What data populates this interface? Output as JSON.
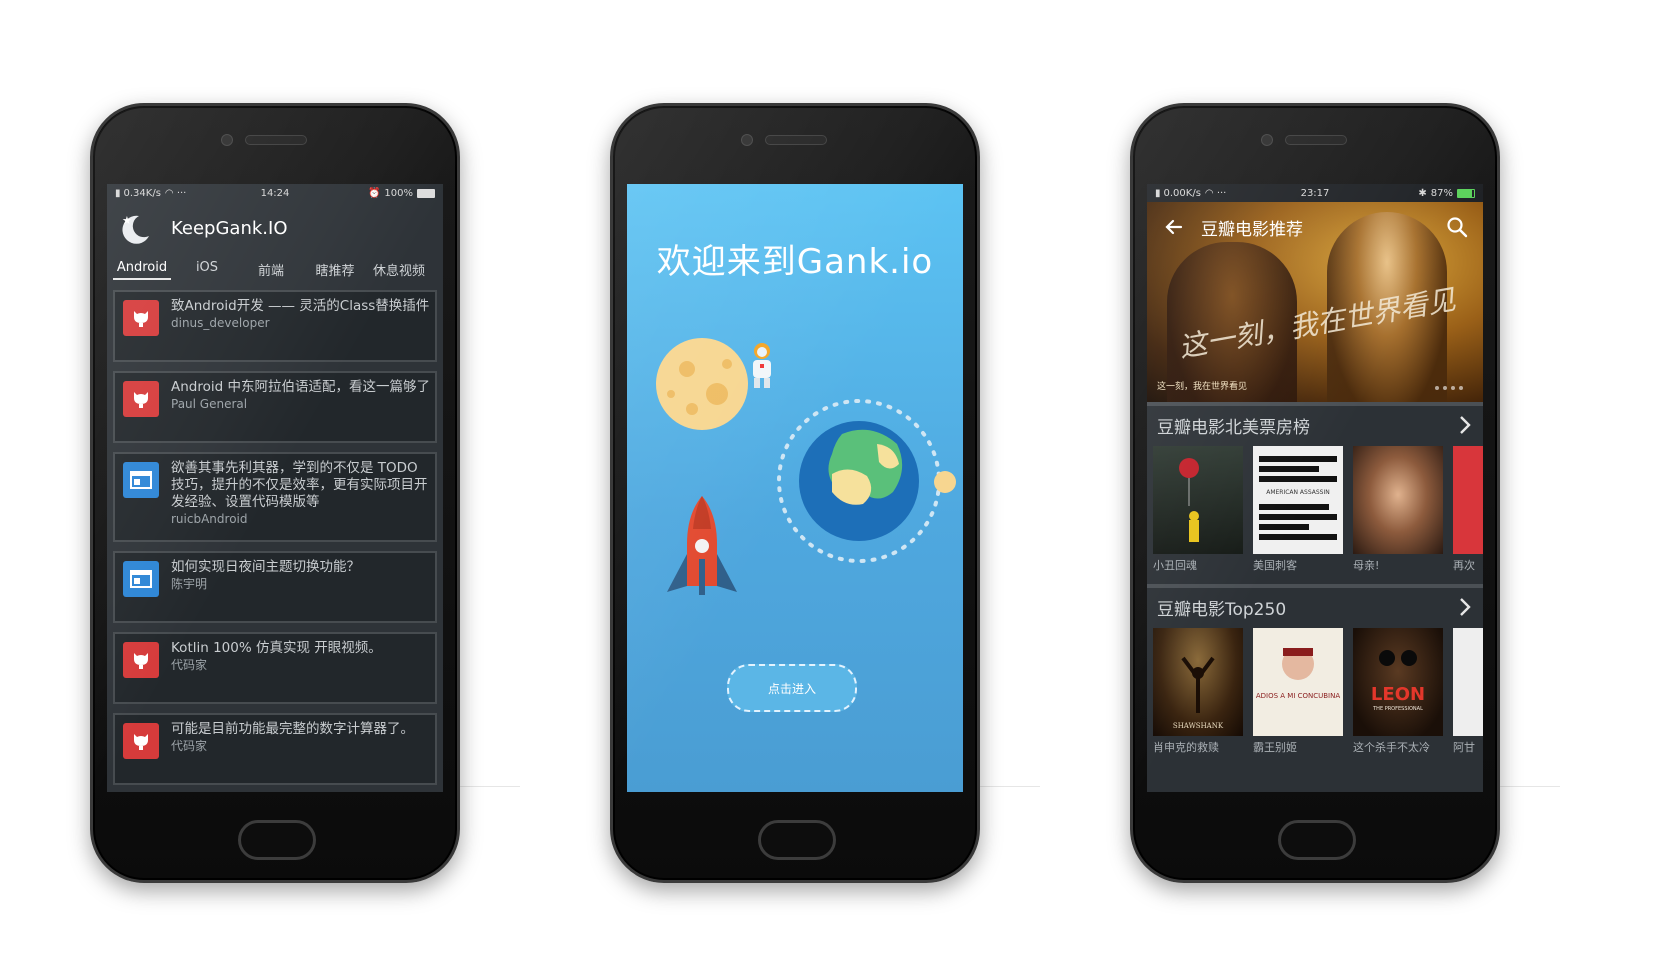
{
  "phone1": {
    "status": {
      "left": "0.34K/s",
      "time": "14:24",
      "battery": "100%",
      "battery_fraction": 1.0
    },
    "app_title": "KeepGank.IO",
    "tabs": [
      {
        "label": "Android",
        "active": true
      },
      {
        "label": "iOS",
        "active": false
      },
      {
        "label": "前端",
        "active": false
      },
      {
        "label": "瞎推荐",
        "active": false
      },
      {
        "label": "休息视频",
        "active": false
      }
    ],
    "items": [
      {
        "icon": "github-icon",
        "title": "致Android开发 —— 灵活的Class替换插件",
        "author": "dinus_developer"
      },
      {
        "icon": "github-icon",
        "title": "Android 中东阿拉伯语适配，看这一篇够了",
        "author": "Paul General"
      },
      {
        "icon": "browser-icon",
        "title": "欲善其事先利其器，学到的不仅是 TODO 技巧，提升的不仅是效率，更有实际项目开发经验、设置代码模版等",
        "author": "ruicbAndroid"
      },
      {
        "icon": "browser-icon",
        "title": "如何实现日夜间主题切换功能？",
        "author": "陈宇明"
      },
      {
        "icon": "github-icon",
        "title": "Kotlin 100% 仿真实现 开眼视频。",
        "author": "代码家"
      },
      {
        "icon": "github-icon",
        "title": "可能是目前功能最完整的数字计算器了。",
        "author": "代码家"
      }
    ]
  },
  "phone2": {
    "welcome": "欢迎来到Gank.io",
    "enter_label": "点击进入"
  },
  "phone3": {
    "status": {
      "left": "0.00K/s",
      "time": "23:17",
      "battery": "87%",
      "battery_fraction": 0.87
    },
    "title": "豆瓣电影推荐",
    "banner": {
      "scrawl": "这一刻，我在世界看见",
      "caption": "这一刻，我在世界看见"
    },
    "section1": {
      "title": "豆瓣电影北美票房榜",
      "movies": [
        {
          "title": "小丑回魂"
        },
        {
          "title": "美国刺客"
        },
        {
          "title": "母亲!"
        },
        {
          "title": "再次"
        }
      ]
    },
    "section2": {
      "title": "豆瓣电影Top250",
      "movies": [
        {
          "title": "肖申克的救赎"
        },
        {
          "title": "霸王别姬"
        },
        {
          "title": "这个杀手不太冷"
        },
        {
          "title": "阿甘"
        }
      ]
    },
    "poster_texts": {
      "american_assassin": "AMERICAN ASSASSIN",
      "shawshank": "SHAWSHANK",
      "adios": "ADIOS A MI CONCUBINA",
      "leon": "LEON",
      "leon_sub": "THE PROFESSIONAL"
    }
  }
}
